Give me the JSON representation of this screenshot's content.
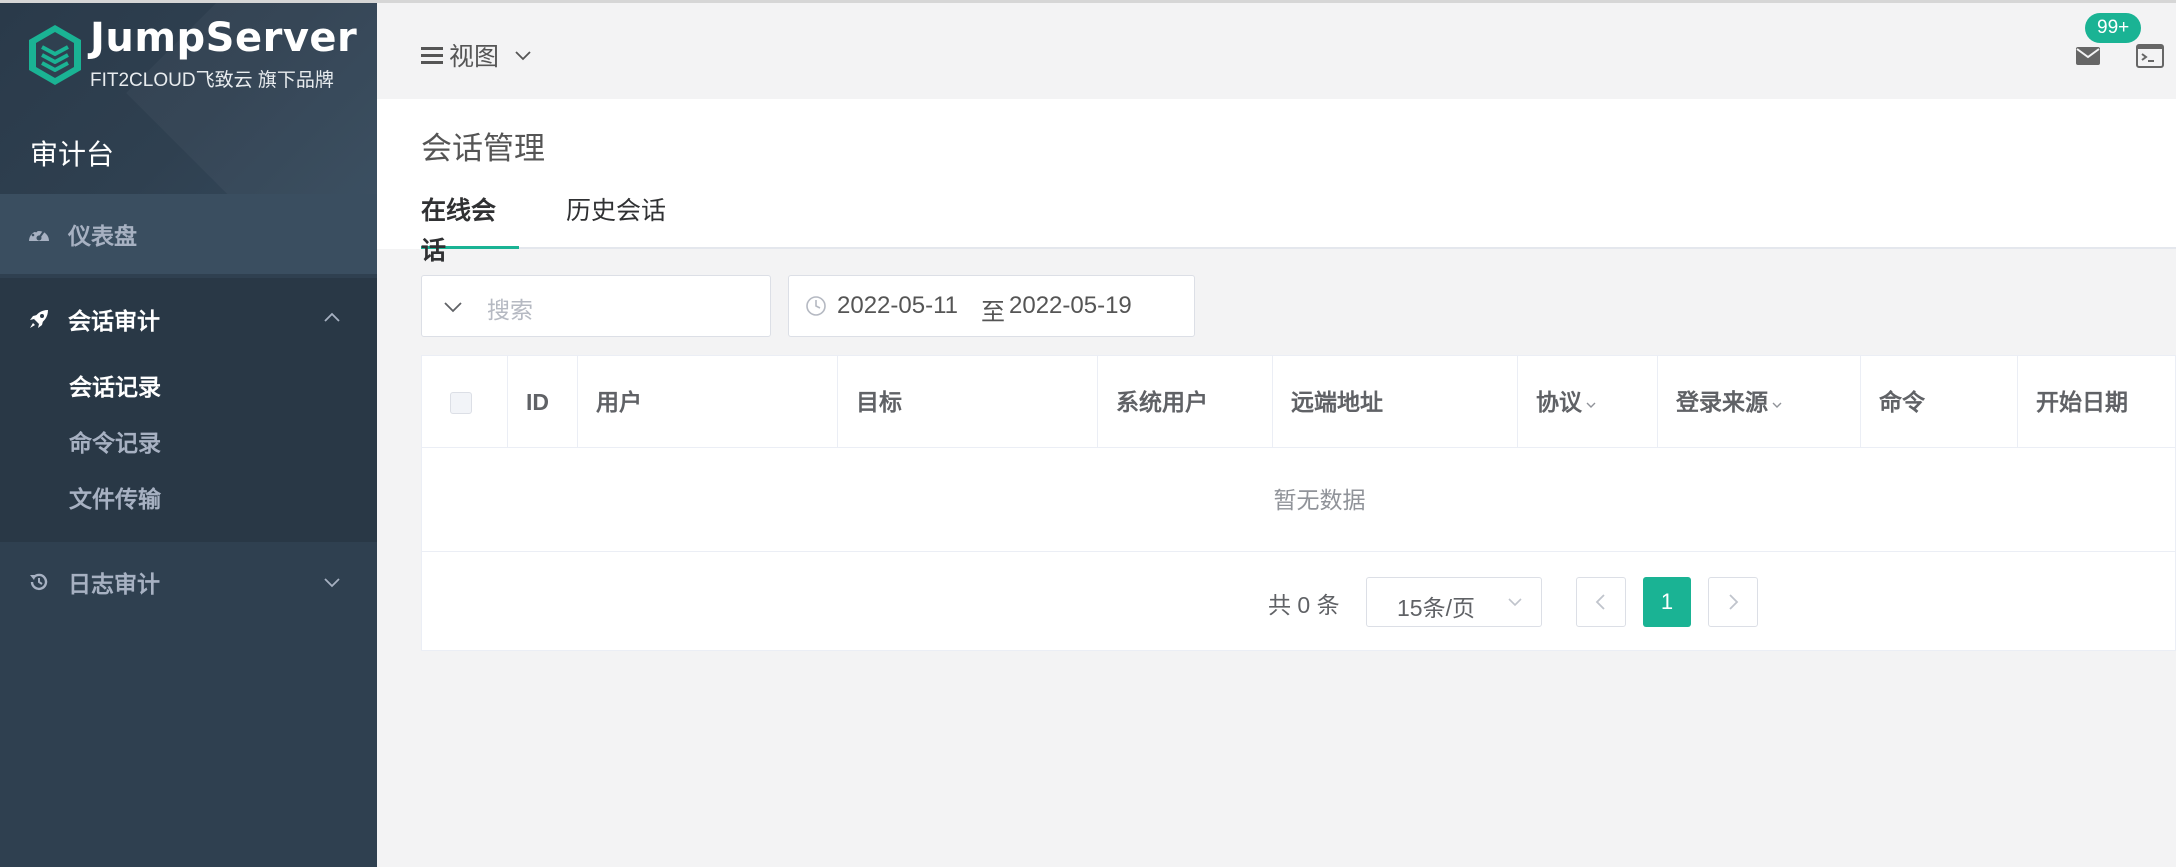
{
  "brand": {
    "name": "JumpServer",
    "tagline": "FIT2CLOUD飞致云 旗下品牌",
    "console_title": "审计台",
    "accent_color": "#1ab394",
    "sidebar_color": "#2f4050"
  },
  "sidebar": {
    "dashboard_label": "仪表盘",
    "session_audit_label": "会话审计",
    "session_audit_items": [
      "会话记录",
      "命令记录",
      "文件传输"
    ],
    "log_audit_label": "日志审计"
  },
  "navbar": {
    "view_label": "视图",
    "notification_badge": "99+"
  },
  "page": {
    "title": "会话管理",
    "tabs": [
      "在线会话",
      "历史会话"
    ],
    "active_tab": "在线会话"
  },
  "filters": {
    "search_placeholder": "搜索",
    "date_start": "2022-05-11",
    "date_separator": "至",
    "date_end": "2022-05-19"
  },
  "table": {
    "columns": [
      "ID",
      "用户",
      "目标",
      "系统用户",
      "远端地址",
      "协议",
      "登录来源",
      "命令",
      "开始日期"
    ],
    "empty_text": "暂无数据"
  },
  "pagination": {
    "total_text": "共 0 条",
    "page_size": "15条/页",
    "current_page": "1"
  }
}
